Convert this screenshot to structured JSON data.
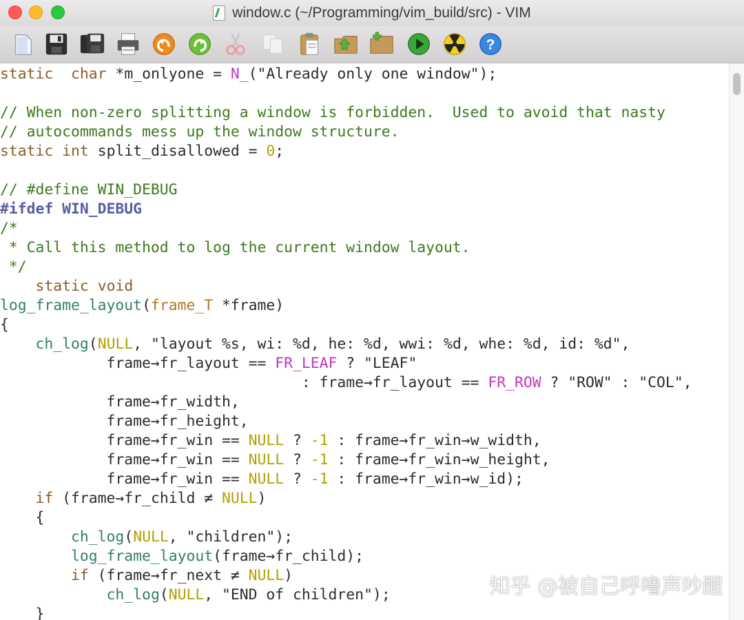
{
  "window": {
    "title": "window.c (~/Programming/vim_build/src) - VIM"
  },
  "toolbar": {
    "icons": [
      "open-icon",
      "save-icon",
      "save-all-icon",
      "print-icon",
      "undo-icon",
      "redo-icon",
      "cut-icon",
      "copy-icon",
      "paste-icon",
      "load-session-icon",
      "save-session-icon",
      "run-script-icon",
      "make-icon",
      "help-icon"
    ]
  },
  "colors": {
    "keyword": "#8a5c2a",
    "comment": "#3c7a1c",
    "number": "#b1a100",
    "macro": "#c236c0",
    "function": "#2f7f66",
    "preprocessor": "#5a5ca3"
  },
  "code": {
    "lines": [
      [
        [
          "k",
          "static"
        ],
        [
          "",
          "  "
        ],
        [
          "k",
          "char"
        ],
        [
          "",
          " *m_onlyone = "
        ],
        [
          "m",
          "N_"
        ],
        [
          "",
          "(\"Already only one window\");"
        ]
      ],
      [],
      [
        [
          "c",
          "// When non-zero splitting a window is forbidden.  Used to avoid that nasty"
        ]
      ],
      [
        [
          "c",
          "// autocommands mess up the window structure."
        ]
      ],
      [
        [
          "k",
          "static"
        ],
        [
          "",
          " "
        ],
        [
          "k",
          "int"
        ],
        [
          "",
          " split_disallowed = "
        ],
        [
          "n",
          "0"
        ],
        [
          "",
          ";"
        ]
      ],
      [],
      [
        [
          "c",
          "// #define WIN_DEBUG"
        ]
      ],
      [
        [
          "p",
          "#ifdef WIN_DEBUG"
        ]
      ],
      [
        [
          "c",
          "/*"
        ]
      ],
      [
        [
          "c",
          " * Call this method to log the current window layout."
        ]
      ],
      [
        [
          "c",
          " */"
        ]
      ],
      [
        [
          "",
          "    "
        ],
        [
          "k",
          "static"
        ],
        [
          "",
          " "
        ],
        [
          "k",
          "void"
        ]
      ],
      [
        [
          "f",
          "log_frame_layout"
        ],
        [
          "",
          "("
        ],
        [
          "ty",
          "frame_T"
        ],
        [
          "",
          " *frame)"
        ]
      ],
      [
        [
          "",
          "{"
        ]
      ],
      [
        [
          "",
          "    "
        ],
        [
          "f",
          "ch_log"
        ],
        [
          "",
          "("
        ],
        [
          "n",
          "NULL"
        ],
        [
          "",
          ", \"layout %s, wi: %d, he: %d, wwi: %d, whe: %d, id: %d\","
        ]
      ],
      [
        [
          "",
          "            frame→fr_layout == "
        ],
        [
          "m",
          "FR_LEAF"
        ],
        [
          "",
          " ? \"LEAF\""
        ]
      ],
      [
        [
          "",
          "                                  : frame→fr_layout == "
        ],
        [
          "m",
          "FR_ROW"
        ],
        [
          "",
          " ? \"ROW\" : \"COL\","
        ]
      ],
      [
        [
          "",
          "            frame→fr_width,"
        ]
      ],
      [
        [
          "",
          "            frame→fr_height,"
        ]
      ],
      [
        [
          "",
          "            frame→fr_win == "
        ],
        [
          "n",
          "NULL"
        ],
        [
          "",
          " ? "
        ],
        [
          "n",
          "-1"
        ],
        [
          "",
          " : frame→fr_win→w_width,"
        ]
      ],
      [
        [
          "",
          "            frame→fr_win == "
        ],
        [
          "n",
          "NULL"
        ],
        [
          "",
          " ? "
        ],
        [
          "n",
          "-1"
        ],
        [
          "",
          " : frame→fr_win→w_height,"
        ]
      ],
      [
        [
          "",
          "            frame→fr_win == "
        ],
        [
          "n",
          "NULL"
        ],
        [
          "",
          " ? "
        ],
        [
          "n",
          "-1"
        ],
        [
          "",
          " : frame→fr_win→w_id);"
        ]
      ],
      [
        [
          "",
          "    "
        ],
        [
          "k",
          "if"
        ],
        [
          "",
          " (frame→fr_child ≠ "
        ],
        [
          "n",
          "NULL"
        ],
        [
          "",
          ")"
        ]
      ],
      [
        [
          "",
          "    {"
        ]
      ],
      [
        [
          "",
          "        "
        ],
        [
          "f",
          "ch_log"
        ],
        [
          "",
          "("
        ],
        [
          "n",
          "NULL"
        ],
        [
          "",
          ", \"children\");"
        ]
      ],
      [
        [
          "",
          "        "
        ],
        [
          "f",
          "log_frame_layout"
        ],
        [
          "",
          "(frame→fr_child);"
        ]
      ],
      [
        [
          "",
          "        "
        ],
        [
          "k",
          "if"
        ],
        [
          "",
          " (frame→fr_next ≠ "
        ],
        [
          "n",
          "NULL"
        ],
        [
          "",
          ")"
        ]
      ],
      [
        [
          "",
          "            "
        ],
        [
          "f",
          "ch_log"
        ],
        [
          "",
          "("
        ],
        [
          "n",
          "NULL"
        ],
        [
          "",
          ", \"END of children\");"
        ]
      ],
      [
        [
          "",
          "    }"
        ]
      ]
    ]
  },
  "watermark": "知乎 @被自己呼噜声吵醒"
}
